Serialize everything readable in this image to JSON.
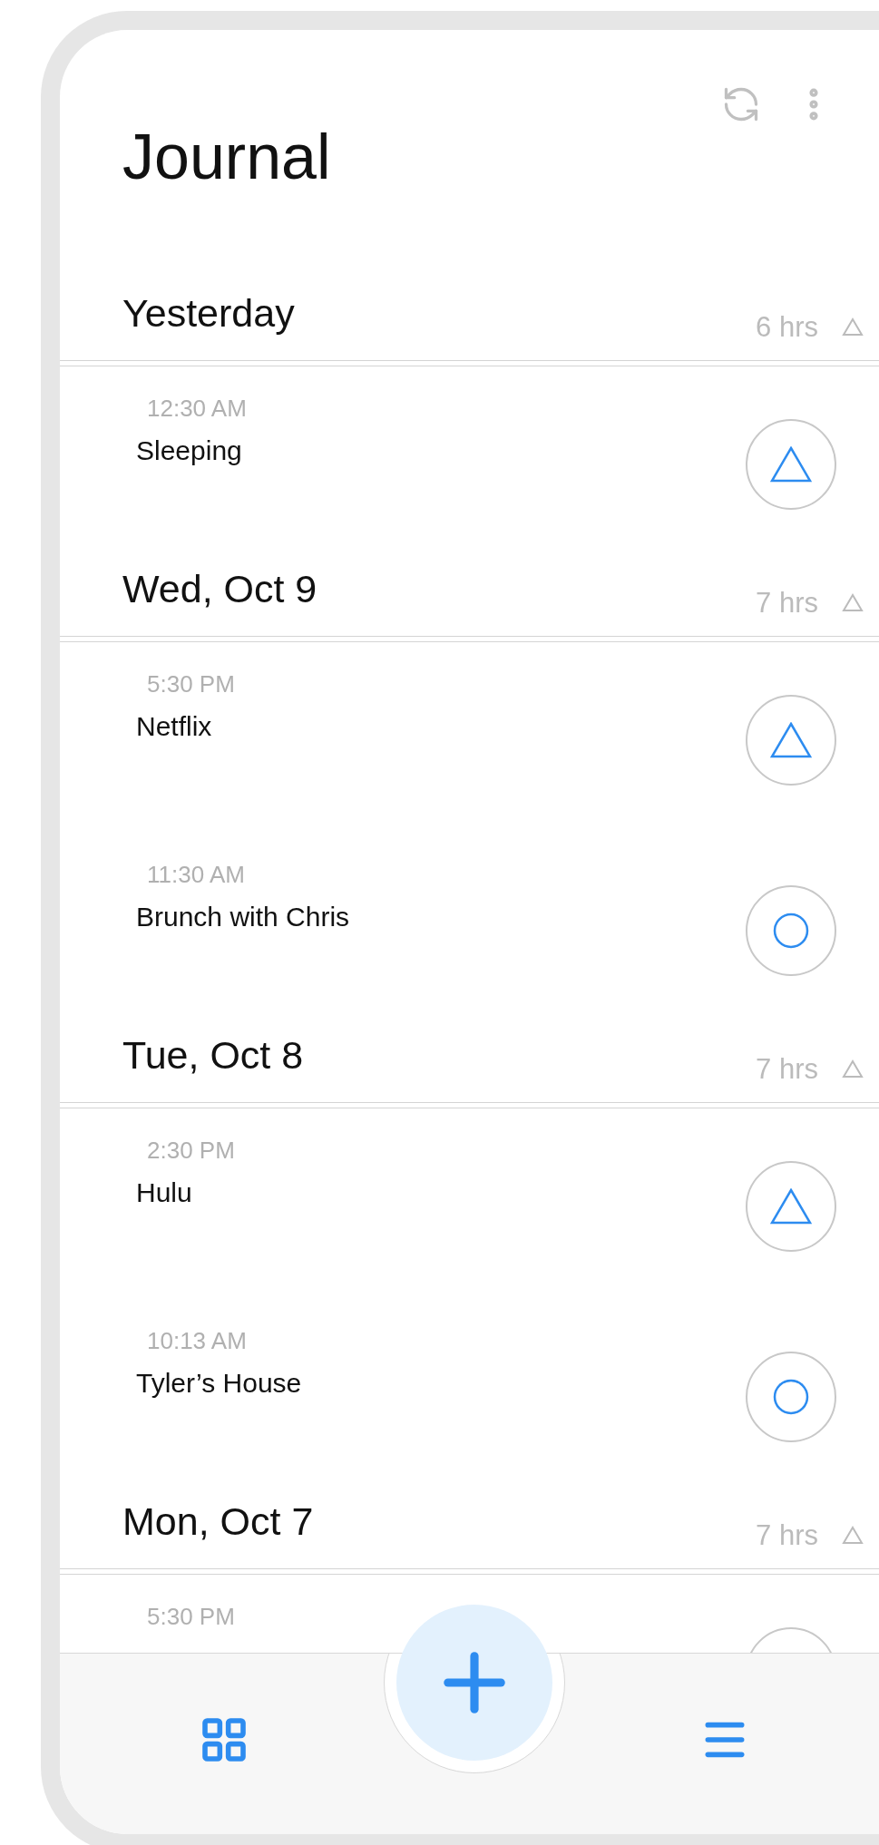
{
  "header": {
    "title": "Journal"
  },
  "sections": [
    {
      "date": "Yesterday",
      "hours": "6 hrs",
      "entries": [
        {
          "time": "12:30 AM",
          "name": "Sleeping",
          "kind": "triangle"
        }
      ]
    },
    {
      "date": "Wed, Oct 9",
      "hours": "7 hrs",
      "entries": [
        {
          "time": "5:30 PM",
          "name": "Netflix",
          "kind": "triangle"
        },
        {
          "time": "11:30 AM",
          "name": "Brunch with Chris",
          "kind": "circle"
        }
      ]
    },
    {
      "date": "Tue, Oct 8",
      "hours": "7 hrs",
      "entries": [
        {
          "time": "2:30 PM",
          "name": "Hulu",
          "kind": "triangle"
        },
        {
          "time": "10:13 AM",
          "name": "Tyler’s House",
          "kind": "circle"
        }
      ]
    },
    {
      "date": "Mon, Oct 7",
      "hours": "7 hrs",
      "entries": [
        {
          "time": "5:30 PM"
        }
      ]
    }
  ]
}
